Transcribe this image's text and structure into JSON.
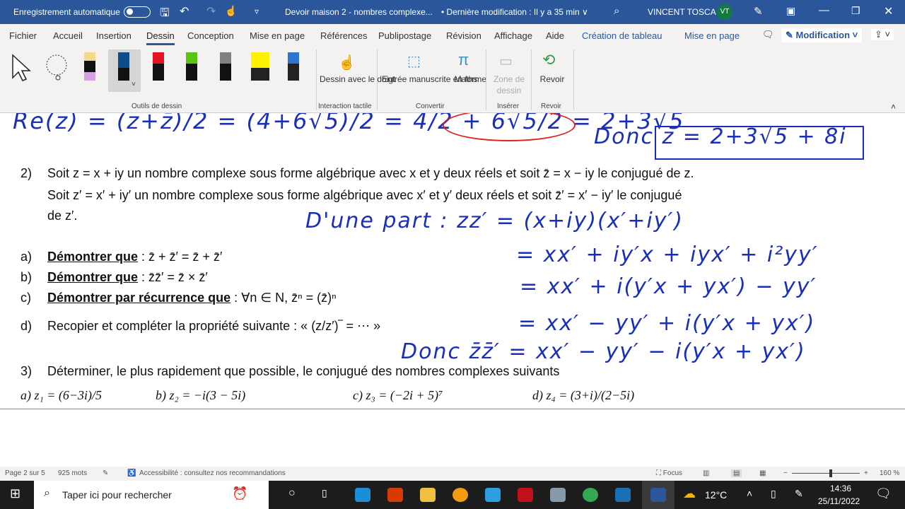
{
  "titlebar": {
    "autosave": "Enregistrement automatique",
    "doc_title": "Devoir maison 2 - nombres complexe...",
    "modified": "• Dernière modification : Il y a 35 min ∨",
    "user": "VINCENT TOSCA",
    "initials": "VT"
  },
  "menu": {
    "items": [
      "Fichier",
      "Accueil",
      "Insertion",
      "Dessin",
      "Conception",
      "Mise en page",
      "Références",
      "Publipostage",
      "Révision",
      "Affichage",
      "Aide",
      "Création de tableau",
      "Mise en page"
    ],
    "mode": "Modification"
  },
  "ribbon": {
    "finger": "Dessin avec le doigt",
    "ink_to_shape": "Entrée manuscrite en forme",
    "math": "Maths",
    "canvas": "Zone de dessin",
    "replay": "Revoir",
    "groups": [
      "Outils de dessin",
      "Interaction tactile",
      "Convertir",
      "Insérer",
      "Revoir"
    ]
  },
  "doc": {
    "hw_top": "Re(z) = (z+z̄)/2 = (4+6√5)/2 = 4/2 + 6√5/2 = 2+3√5",
    "hw_donc_z": "Donc  z = 2+3√5 + 8i",
    "q2_num": "2)",
    "q2_l1": "Soit z = x + iy  un nombre complexe sous forme algébrique avec  x et y deux réels et soit z̄ = x − iy le conjugué de z.",
    "q2_l2": "Soit z′ = x′ + iy′  un nombre complexe sous forme algébrique avec  x′ et y′ deux réels et soit z̄′ = x′ − iy′ le conjugué",
    "q2_l3": "de z′.",
    "items": [
      {
        "k": "a)",
        "b": "Démontrer que",
        "r": " : z̄ + z̄′ = z̄ + z̄′"
      },
      {
        "k": "b)",
        "b": "Démontrer que",
        "r": " : z̄z̄′ = z̄ × z̄′"
      },
      {
        "k": "c)",
        "b": "Démontrer par récurrence que",
        "r": " : ∀n ∈ N,  z̄ⁿ = (z̄)ⁿ"
      },
      {
        "k": "d)",
        "b": "",
        "r": "Recopier et compléter la propriété suivante : « (z/z′)‾ = ⋯ »"
      }
    ],
    "q3_num": "3)",
    "q3": "Déterminer, le plus rapidement que possible, le conjugué des nombres complexes suivants",
    "q3_items": [
      "a)  z₁ = (6−3i)/5",
      "b) z₂ = −i(3 − 5i)",
      "c) z₃ = (−2i + 5)⁷",
      "d) z₄ = (3+i)/(2−5i)"
    ],
    "hw": [
      "D'une part :  zz′ = (x+iy)(x′+iy′)",
      "= xx′ + iy′x + iyx′ + i²yy′",
      "= xx′ + i(y′x + yx′) − yy′",
      "= xx′ − yy′ + i(y′x + yx′)",
      "Donc  z̄z̄′ = xx′ − yy′ − i(y′x + yx′)"
    ]
  },
  "status": {
    "page": "Page 2 sur 5",
    "words": "925 mots",
    "accessibility": "Accessibilité : consultez nos recommandations",
    "focus": "Focus",
    "zoom": "160 %"
  },
  "taskbar": {
    "search": "Taper ici pour rechercher",
    "weather": "12°C",
    "time": "14:36",
    "date": "25/11/2022"
  }
}
